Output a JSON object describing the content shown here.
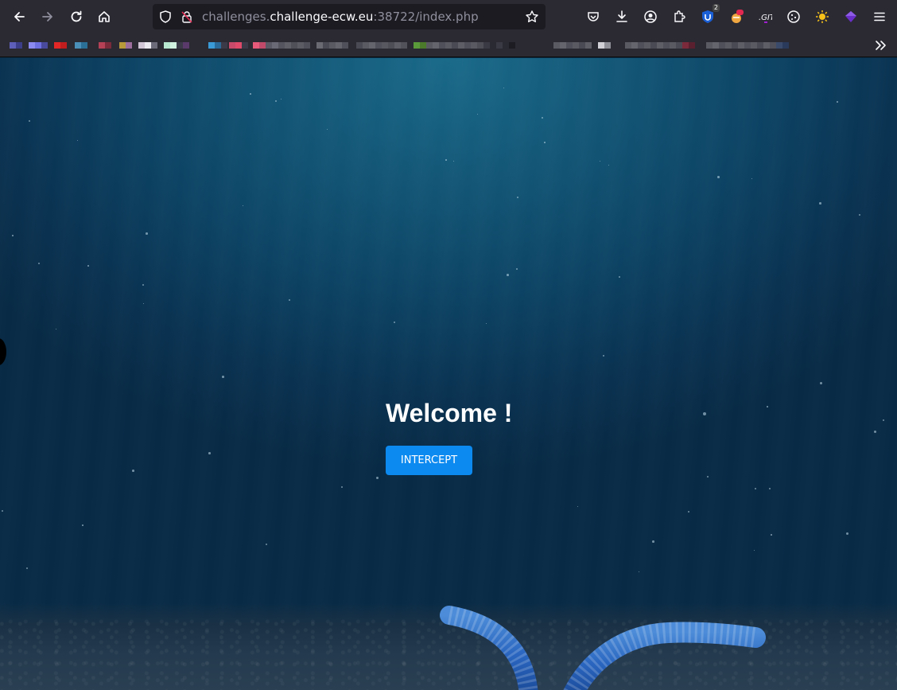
{
  "browser": {
    "url_prefix": "challenges.",
    "url_host": "challenge-ecw.eu",
    "url_suffix": ":38722/index.php",
    "toolbar_icons": [
      "back-icon",
      "forward-icon",
      "reload-icon",
      "home-icon"
    ],
    "url_icons": [
      "shield-icon",
      "lock-icon",
      "bookmark-star-icon"
    ],
    "extension_icons": [
      "pocket-icon",
      "download-icon",
      "account-icon",
      "extensions-icon",
      "ublock-icon",
      "ext-badge-icon",
      "cookie-icon",
      "sun-icon",
      "purple-ext-icon",
      "menu-icon"
    ],
    "ublock_badge": "2",
    "overflow_icon": "chevrons-right-icon"
  },
  "page": {
    "heading": "Welcome !",
    "button_label": "INTERCEPT"
  },
  "colors": {
    "chrome_bg": "#2b2a33",
    "url_bg": "#1c1b22",
    "button_bg": "#0d8af0",
    "sea_top": "#1a6a8a",
    "sea_bottom": "#082a45"
  }
}
